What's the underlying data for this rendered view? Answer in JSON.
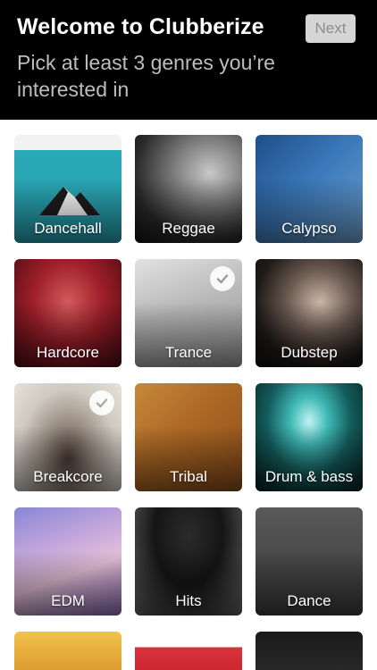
{
  "header": {
    "title": "Welcome to Clubberize",
    "next_label": "Next",
    "subtitle": "Pick at least 3 genres you’re interested in"
  },
  "genres": [
    {
      "label": "Dancehall",
      "selected": false
    },
    {
      "label": "Reggae",
      "selected": false
    },
    {
      "label": "Calypso",
      "selected": false
    },
    {
      "label": "Hardcore",
      "selected": false
    },
    {
      "label": "Trance",
      "selected": true
    },
    {
      "label": "Dubstep",
      "selected": false
    },
    {
      "label": "Breakcore",
      "selected": true
    },
    {
      "label": "Tribal",
      "selected": false
    },
    {
      "label": "Drum & bass",
      "selected": false
    },
    {
      "label": "EDM",
      "selected": false
    },
    {
      "label": "Hits",
      "selected": false
    },
    {
      "label": "Dance",
      "selected": false
    }
  ],
  "icons": {
    "selected": "checkmark-icon"
  },
  "colors": {
    "header_bg": "#000000",
    "title": "#ffffff",
    "subtitle": "#bdbdbd",
    "next_bg": "#d5d5d5",
    "next_text": "#8e8e8e"
  }
}
